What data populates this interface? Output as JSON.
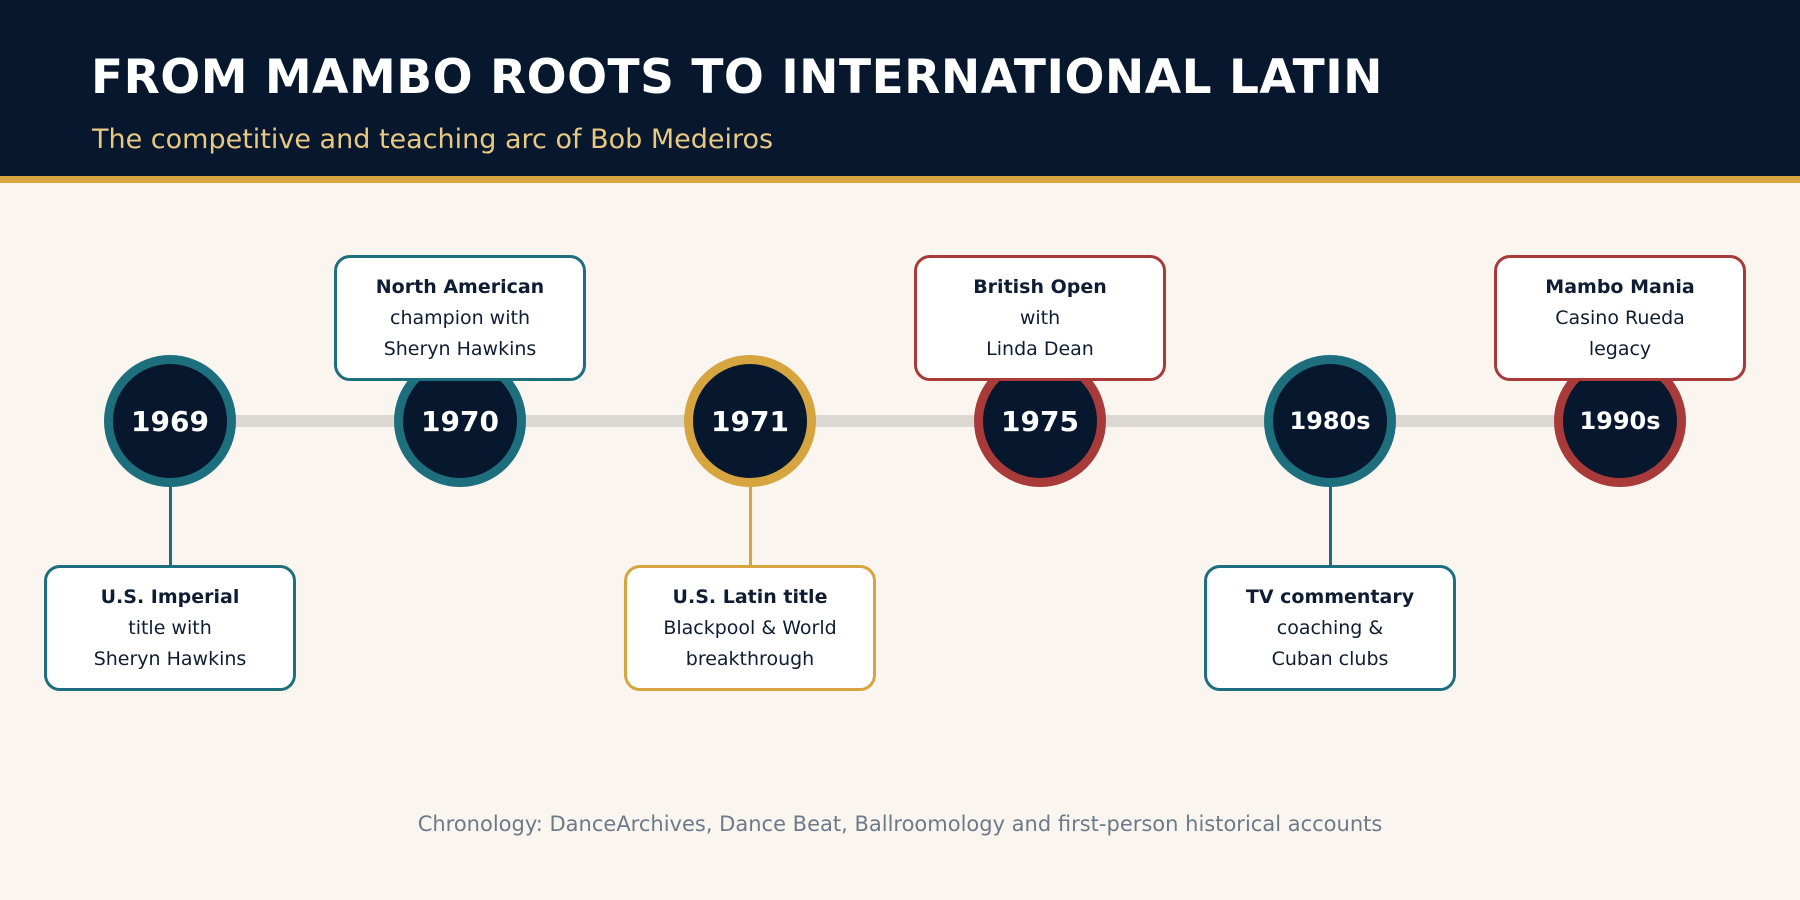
{
  "header": {
    "title": "FROM MAMBO ROOTS TO INTERNATIONAL LATIN",
    "subtitle": "The competitive and teaching arc of Bob Medeiros"
  },
  "colors": {
    "teal": "#1e6f7e",
    "gold": "#d6a540",
    "red": "#a83a3a",
    "navy": "#07172d",
    "cream": "#faf5ee"
  },
  "events": [
    {
      "year": "1969",
      "head": "U.S. Imperial",
      "line2": "title with",
      "line3": "Sheryn Hawkins",
      "position": "below",
      "color": "teal"
    },
    {
      "year": "1970",
      "head": "North American",
      "line2": "champion with",
      "line3": "Sheryn Hawkins",
      "position": "above",
      "color": "teal"
    },
    {
      "year": "1971",
      "head": "U.S. Latin title",
      "line2": "Blackpool & World",
      "line3": "breakthrough",
      "position": "below",
      "color": "gold"
    },
    {
      "year": "1975",
      "head": "British Open",
      "line2": "with",
      "line3": "Linda Dean",
      "position": "above",
      "color": "red"
    },
    {
      "year": "1980s",
      "head": "TV commentary",
      "line2": "coaching &",
      "line3": "Cuban clubs",
      "position": "below",
      "color": "teal"
    },
    {
      "year": "1990s",
      "head": "Mambo Mania",
      "line2": "Casino Rueda",
      "line3": "legacy",
      "position": "above",
      "color": "red"
    }
  ],
  "footer": {
    "source": "Chronology: DanceArchives, Dance Beat, Ballroomology and first-person historical accounts"
  }
}
